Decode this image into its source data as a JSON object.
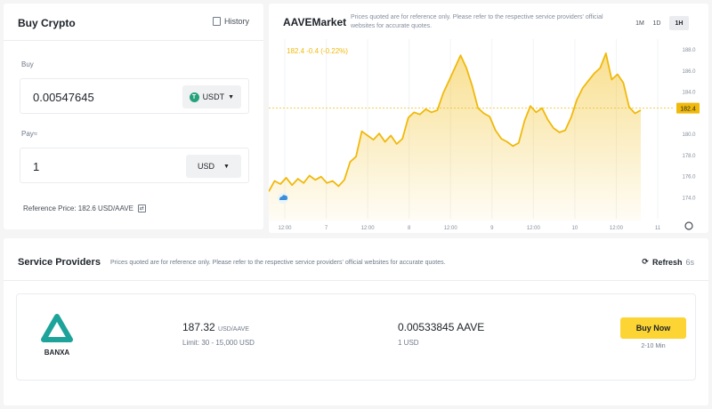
{
  "buy_panel": {
    "title": "Buy Crypto",
    "history_label": "History",
    "buy_label": "Buy",
    "buy_amount": "0.00547645",
    "buy_coin": "USDT",
    "pay_label": "Pay≈",
    "pay_amount": "1",
    "pay_currency": "USD",
    "reference_price": "Reference Price: 182.6 USD/AAVE"
  },
  "market": {
    "title": "AAVEMarket",
    "note": "Prices quoted are for reference only. Please refer to the respective service providers' official websites for accurate quotes.",
    "timeframes": [
      {
        "label": "1M",
        "active": false
      },
      {
        "label": "1D",
        "active": false
      },
      {
        "label": "1H",
        "active": true
      }
    ],
    "live_readout": "182.4  -0.4 (-0.22%)",
    "current_price_tag": "182.4",
    "accent_color": "#f0b90b"
  },
  "chart_data": {
    "type": "area",
    "x_ticks": [
      "12:00",
      "7",
      "12:00",
      "8",
      "12:00",
      "9",
      "12:00",
      "10",
      "12:00",
      "11"
    ],
    "y_ticks": [
      "188.0",
      "186.0",
      "184.0",
      "182.0",
      "180.0",
      "178.0",
      "176.0",
      "174.0"
    ],
    "ylim": [
      173.6,
      188.6
    ],
    "current": 182.4,
    "values": [
      174.5,
      175.5,
      175.2,
      175.8,
      175.1,
      175.7,
      175.3,
      176.0,
      175.6,
      175.9,
      175.3,
      175.5,
      175.0,
      175.6,
      177.3,
      177.8,
      180.2,
      179.8,
      179.4,
      180.0,
      179.2,
      179.8,
      179.0,
      179.5,
      181.5,
      182.0,
      181.8,
      182.3,
      182.0,
      182.2,
      183.8,
      185.0,
      186.2,
      187.4,
      186.2,
      184.5,
      182.4,
      181.9,
      181.6,
      180.3,
      179.5,
      179.2,
      178.8,
      179.1,
      181.2,
      182.6,
      182.0,
      182.4,
      181.3,
      180.5,
      180.1,
      180.3,
      181.5,
      183.2,
      184.3,
      185.0,
      185.7,
      186.2,
      187.6,
      185.1,
      185.6,
      184.8,
      182.5,
      181.9,
      182.2
    ]
  },
  "providers": {
    "title": "Service Providers",
    "note": "Prices quoted are for reference only. Please refer to the respective service providers' official websites for accurate quotes.",
    "refresh_label": "Refresh",
    "refresh_countdown": "6s",
    "items": [
      {
        "name": "BANXA",
        "rate": "187.32",
        "rate_unit": "USD/AAVE",
        "limit": "Limit: 30 - 15,000 USD",
        "amount": "0.00533845 AAVE",
        "fiat": "1 USD",
        "button_label": "Buy Now",
        "time": "2-10 Min"
      }
    ]
  }
}
